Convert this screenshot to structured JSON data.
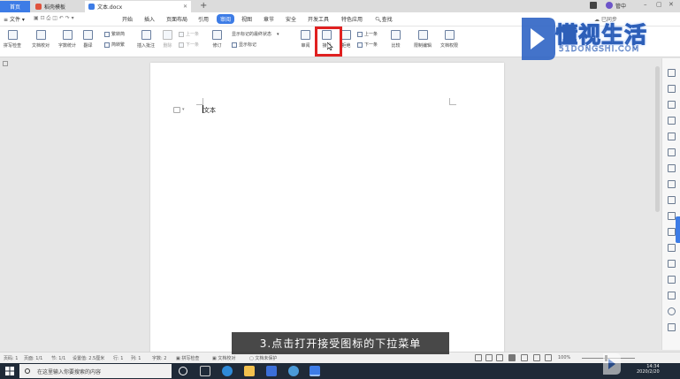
{
  "tabs": {
    "home": "首页",
    "template": "稻壳模板",
    "doc": "文本.docx"
  },
  "menu": {
    "file": "文件",
    "items": [
      "开始",
      "插入",
      "页面布局",
      "引用",
      "审阅",
      "视图",
      "章节",
      "安全",
      "开发工具",
      "特色应用"
    ],
    "search": "查找",
    "collab": "已同步",
    "user": "管中"
  },
  "ribbon": {
    "spell": "拼写检查",
    "word_count_doc": "文档校对",
    "word_count": "字数统计",
    "translate": "翻译",
    "simp": "繁转简",
    "trad": "简转繁",
    "insert_comment": "插入批注",
    "delete_comment": "删除",
    "prev_comment": "上一条",
    "next_comment": "下一条",
    "revise": "修订",
    "show_markup_state": "显示标记的最终状态",
    "show_markup": "显示标记",
    "review": "审阅",
    "accept": "接受",
    "reject": "拒绝",
    "prev": "上一条",
    "next": "下一条",
    "compare": "比较",
    "restrict_edit": "限制编辑",
    "doc_rights": "文档权限"
  },
  "document": {
    "text": "文本"
  },
  "status": {
    "page_num": "页码: 1",
    "page": "页面: 1/1",
    "section": "节: 1/1",
    "setting": "设置值: 2.5厘米",
    "row": "行: 1",
    "col": "列: 1",
    "chars": "字数: 2",
    "spell": "拼写检查",
    "proof": "文档校对",
    "unprotected": "文档未保护",
    "zoom": "100%"
  },
  "caption": "3.点击打开接受图标的下拉菜单",
  "taskbar": {
    "search_placeholder": "在这里输入你要搜索的内容",
    "time": "14:34",
    "date": "2020/2/20"
  },
  "watermark": {
    "main": "懂视生活",
    "sub": "51DONGSHI.COM"
  },
  "colors": {
    "accent": "#3d7ce6",
    "highlight": "#e02020",
    "taskbar": "#1f2a38"
  }
}
